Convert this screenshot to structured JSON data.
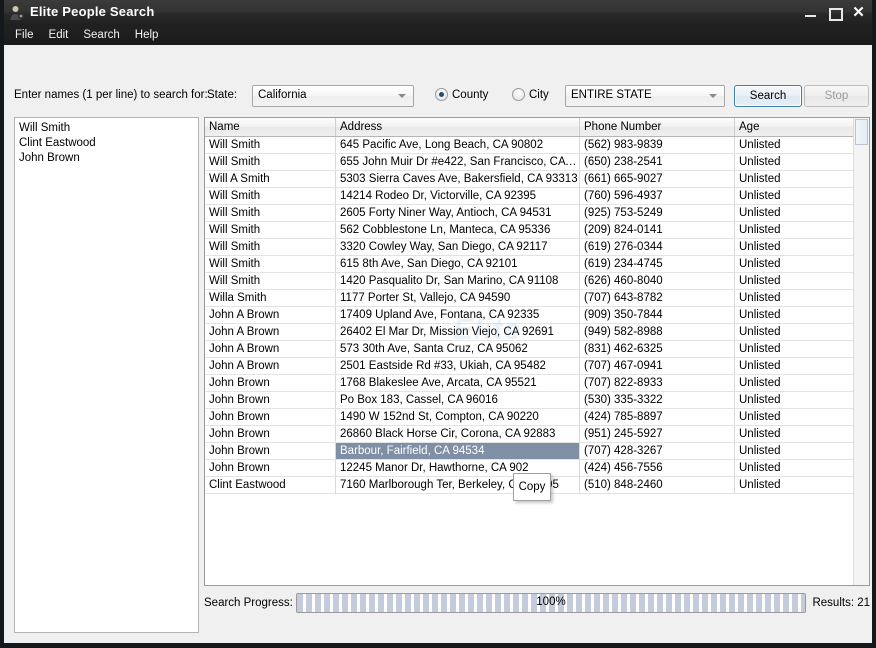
{
  "window": {
    "title": "Elite People Search",
    "icon": "person-icon",
    "controls": {
      "minimize": "–",
      "maximize": "□",
      "close": "✕"
    }
  },
  "menubar": {
    "items": [
      {
        "label": "File"
      },
      {
        "label": "Edit"
      },
      {
        "label": "Search"
      },
      {
        "label": "Help"
      }
    ]
  },
  "toolbar": {
    "names_label": "Enter names (1 per line) to search for:",
    "state_label": "State:",
    "state_value": "California",
    "scope": {
      "county_label": "County",
      "city_label": "City",
      "selected": "County"
    },
    "area_value": "ENTIRE STATE",
    "search_label": "Search",
    "stop_label": "Stop"
  },
  "names_input": {
    "value": "Will Smith\nClint Eastwood\nJohn Brown"
  },
  "results_table": {
    "columns": [
      "Name",
      "Address",
      "Phone Number",
      "Age"
    ],
    "rows": [
      {
        "name": "Will Smith",
        "address": "645 Pacific Ave, Long Beach, CA 90802",
        "phone": "(562) 983-9839",
        "age": "Unlisted",
        "selected": false
      },
      {
        "name": "Will Smith",
        "address": "655 John Muir Dr #e422, San Francisco, CA 9…",
        "phone": "(650) 238-2541",
        "age": "Unlisted",
        "selected": false
      },
      {
        "name": "Will A Smith",
        "address": "5303 Sierra Caves Ave, Bakersfield, CA 93313",
        "phone": "(661) 665-9027",
        "age": "Unlisted",
        "selected": false
      },
      {
        "name": "Will Smith",
        "address": "14214 Rodeo Dr, Victorville, CA 92395",
        "phone": "(760) 596-4937",
        "age": "Unlisted",
        "selected": false
      },
      {
        "name": "Will Smith",
        "address": "2605 Forty Niner Way, Antioch, CA 94531",
        "phone": "(925) 753-5249",
        "age": "Unlisted",
        "selected": false
      },
      {
        "name": "Will Smith",
        "address": "562 Cobblestone Ln, Manteca, CA 95336",
        "phone": "(209) 824-0141",
        "age": "Unlisted",
        "selected": false
      },
      {
        "name": "Will Smith",
        "address": "3320 Cowley Way, San Diego, CA 92117",
        "phone": "(619) 276-0344",
        "age": "Unlisted",
        "selected": false
      },
      {
        "name": "Will Smith",
        "address": "615 8th Ave, San Diego, CA 92101",
        "phone": "(619) 234-4745",
        "age": "Unlisted",
        "selected": false
      },
      {
        "name": "Will Smith",
        "address": "1420 Pasqualito Dr, San Marino, CA 91108",
        "phone": "(626) 460-8040",
        "age": "Unlisted",
        "selected": false
      },
      {
        "name": "Willa Smith",
        "address": "1177 Porter St, Vallejo, CA 94590",
        "phone": "(707) 643-8782",
        "age": "Unlisted",
        "selected": false
      },
      {
        "name": "John A Brown",
        "address": "17409 Upland Ave, Fontana, CA 92335",
        "phone": "(909) 350-7844",
        "age": "Unlisted",
        "selected": false
      },
      {
        "name": "John A Brown",
        "address": "26402 El Mar Dr, Mission Viejo, CA 92691",
        "phone": "(949) 582-8988",
        "age": "Unlisted",
        "selected": false
      },
      {
        "name": "John A Brown",
        "address": "573 30th Ave, Santa Cruz, CA 95062",
        "phone": "(831) 462-6325",
        "age": "Unlisted",
        "selected": false
      },
      {
        "name": "John A Brown",
        "address": "2501 Eastside Rd #33, Ukiah, CA 95482",
        "phone": "(707) 467-0941",
        "age": "Unlisted",
        "selected": false
      },
      {
        "name": "John Brown",
        "address": "1768 Blakeslee Ave, Arcata, CA 95521",
        "phone": "(707) 822-8933",
        "age": "Unlisted",
        "selected": false
      },
      {
        "name": "John Brown",
        "address": "Po Box 183, Cassel, CA 96016",
        "phone": "(530) 335-3322",
        "age": "Unlisted",
        "selected": false
      },
      {
        "name": "John Brown",
        "address": "1490 W 152nd St, Compton, CA 90220",
        "phone": "(424) 785-8897",
        "age": "Unlisted",
        "selected": false
      },
      {
        "name": "John Brown",
        "address": "26860 Black Horse Cir, Corona, CA 92883",
        "phone": "(951) 245-5927",
        "age": "Unlisted",
        "selected": false
      },
      {
        "name": "John Brown",
        "address": "Barbour, Fairfield, CA 94534",
        "phone": "(707) 428-3267",
        "age": "Unlisted",
        "selected": true
      },
      {
        "name": "John Brown",
        "address": "12245 Manor Dr, Hawthorne, CA 902",
        "phone": "(424) 456-7556",
        "age": "Unlisted",
        "selected": false
      },
      {
        "name": "Clint Eastwood",
        "address": "7160 Marlborough Ter, Berkeley, CA 94705",
        "phone": "(510) 848-2460",
        "age": "Unlisted",
        "selected": false
      }
    ]
  },
  "context_menu": {
    "copy_label": "Copy"
  },
  "statusbar": {
    "progress_label": "Search Progress:",
    "progress_percent": "100%",
    "results_label": "Results: 21"
  },
  "colors": {
    "titlebar": "#2a2a2a",
    "selection": "#7f8fa6",
    "accent_button_border": "#3c7fb1",
    "progress_fill": "#c3cbdc"
  }
}
